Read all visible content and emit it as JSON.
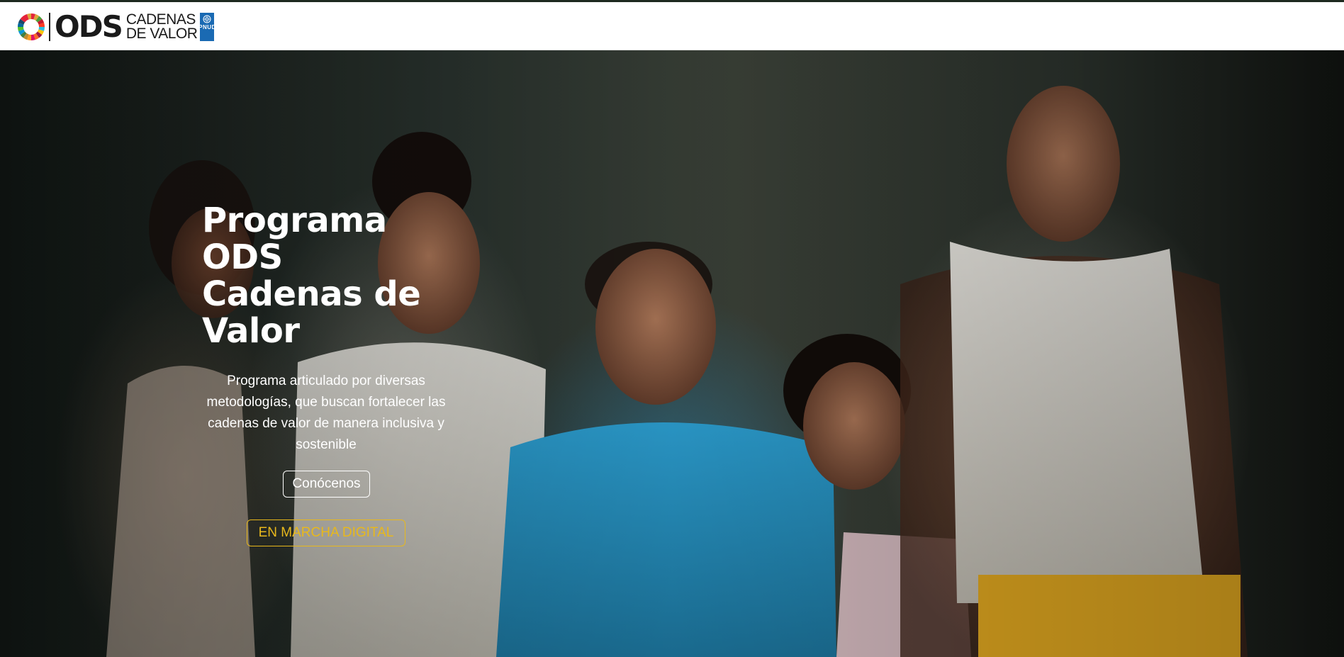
{
  "header": {
    "logo": {
      "wordmark": "ODS",
      "subline_1": "CADENAS",
      "subline_2": "DE VALOR",
      "partner": "PNUD"
    }
  },
  "hero": {
    "title_lines": [
      "Programa",
      "ODS",
      "Cadenas de",
      "Valor"
    ],
    "description": "Programa articulado por diversas metodologías, que buscan fortalecer las cadenas de valor de manera inclusiva y sostenible",
    "button_about": "Conócenos",
    "button_digital": "EN MARCHA DIGITAL"
  },
  "colors": {
    "accent_yellow": "#e8b81c",
    "undp_blue": "#1a6ab3",
    "header_bg": "#ffffff"
  },
  "icons": {
    "sdg_wheel": "sdg-wheel-icon",
    "un_emblem": "un-emblem-icon"
  }
}
